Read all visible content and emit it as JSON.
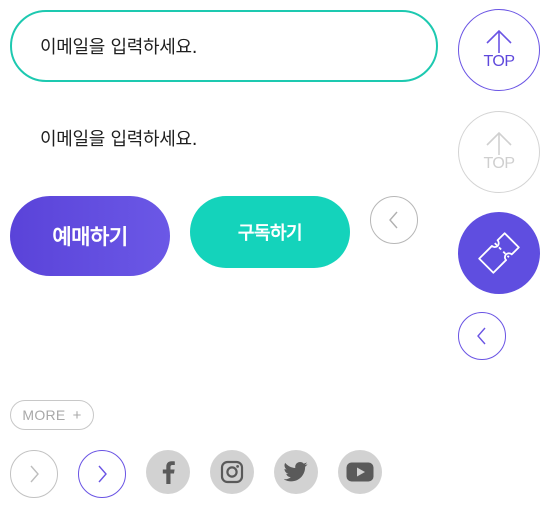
{
  "inputs": {
    "email_active_placeholder": "이메일을 입력하세요.",
    "email_plain_placeholder": "이메일을 입력하세요."
  },
  "buttons": {
    "reserve_label": "예매하기",
    "subscribe_label": "구독하기",
    "top_label_active": "TOP",
    "top_label_disabled": "TOP",
    "more_label": "MORE",
    "more_plus": "+"
  },
  "icons": {
    "prev_small": "chevron-left-icon",
    "top_arrow": "arrow-up-icon",
    "ticket": "ticket-icon",
    "prev": "chevron-left-icon",
    "next": "chevron-right-icon",
    "facebook": "facebook-icon",
    "instagram": "instagram-icon",
    "twitter": "twitter-icon",
    "youtube": "youtube-icon"
  },
  "colors": {
    "accent_purple": "#5f4ee0",
    "accent_teal": "#14d3bb",
    "input_border_active": "#1dc9b0",
    "disabled_grey": "#d2d2d2"
  }
}
